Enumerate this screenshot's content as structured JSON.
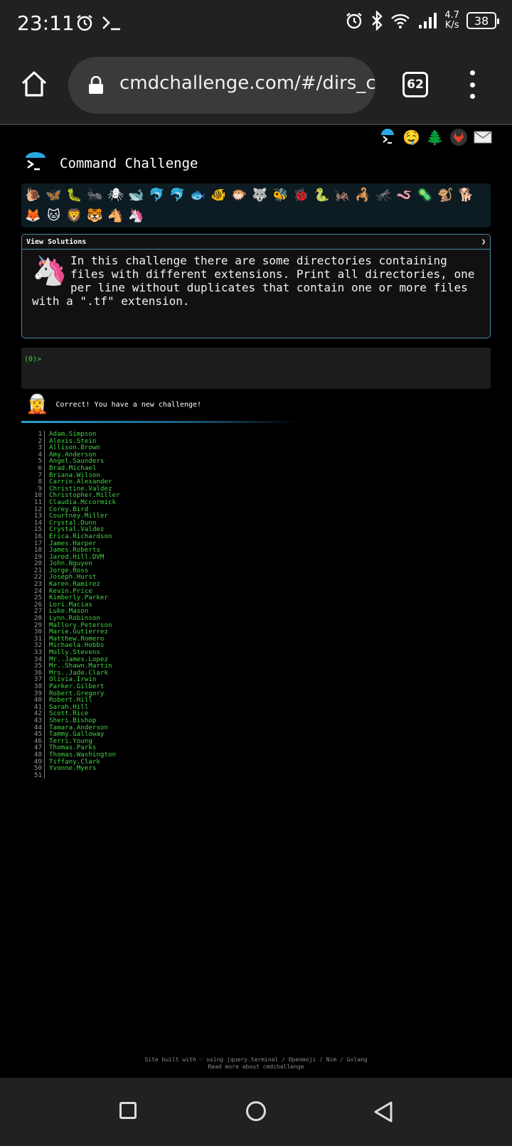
{
  "status_bar": {
    "time": "23:11",
    "speed_value": "4.7",
    "speed_unit": "K/s",
    "battery": "38"
  },
  "browser": {
    "url": "cmdchallenge.com/#/dirs_co",
    "tab_count": "62"
  },
  "site": {
    "title": "Command Challenge",
    "top_icons": [
      "terminal-icon",
      "drooling-face-icon",
      "tree-icon",
      "gitlab-icon",
      "mail-icon"
    ],
    "badges": [
      "🐌",
      "🦋",
      "🐛",
      "🐜",
      "🕷",
      "🐋",
      "🐬",
      "🐬",
      "🐟",
      "🐠",
      "🐡",
      "🐺",
      "🐝",
      "🐞",
      "🐍",
      "🦗",
      "🦂",
      "🦟",
      "🪱",
      "🦠",
      "🐒",
      "🐕",
      "🦊",
      "🐱",
      "🦁",
      "🐯",
      "🐴",
      "🦄"
    ],
    "view_solutions_label": "View Solutions",
    "challenge_text": "In this challenge there are some directories containing files with different extensions. Print all directories, one per line without duplicates that contain one or more files with a \".tf\" extension.",
    "prompt": "(0)>",
    "result_message": "Correct! You have a new challenge!",
    "output_lines": [
      "Adam.Simpson",
      "Alexis.Stein",
      "Allison.Brown",
      "Amy.Anderson",
      "Angel.Saunders",
      "Brad.Michael",
      "Briana.Wilson",
      "Carrie.Alexander",
      "Christine.Valdez",
      "Christopher.Miller",
      "Claudia.Mccormick",
      "Corey.Bird",
      "Courtney.Miller",
      "Crystal.Dunn",
      "Crystal.Valdez",
      "Erica.Richardson",
      "James.Harper",
      "James.Roberts",
      "Jared.Hill.DVM",
      "John.Nguyen",
      "Jorge.Ross",
      "Joseph.Hurst",
      "Karen.Ramirez",
      "Kevin.Price",
      "Kimberly.Parker",
      "Lori.Macias",
      "Luke.Mason",
      "Lynn.Robinson",
      "Mallory.Peterson",
      "Marie.Gutierrez",
      "Matthew.Romero",
      "Michaela.Hobbs",
      "Molly.Stevens",
      "Mr..James.Lopez",
      "Mr..Shawn.Martin",
      "Mrs..Jade.Clark",
      "Olivia.Irwin",
      "Parker.Gilbert",
      "Robert.Gregory",
      "Robert.Hill",
      "Sarah.Hill",
      "Scott.Rice",
      "Sheri.Bishop",
      "Tamara.Anderson",
      "Tammy.Galloway",
      "Terri.Young",
      "Thomas.Parks",
      "Thomas.Washington",
      "Tiffany.Clark",
      "Yvonne.Myers",
      ""
    ],
    "footer_line1": "Site built with ♡ using jquery.terminal / Openmoji / Nim / Golang",
    "footer_line2": "Read more about cmdchallenge"
  }
}
